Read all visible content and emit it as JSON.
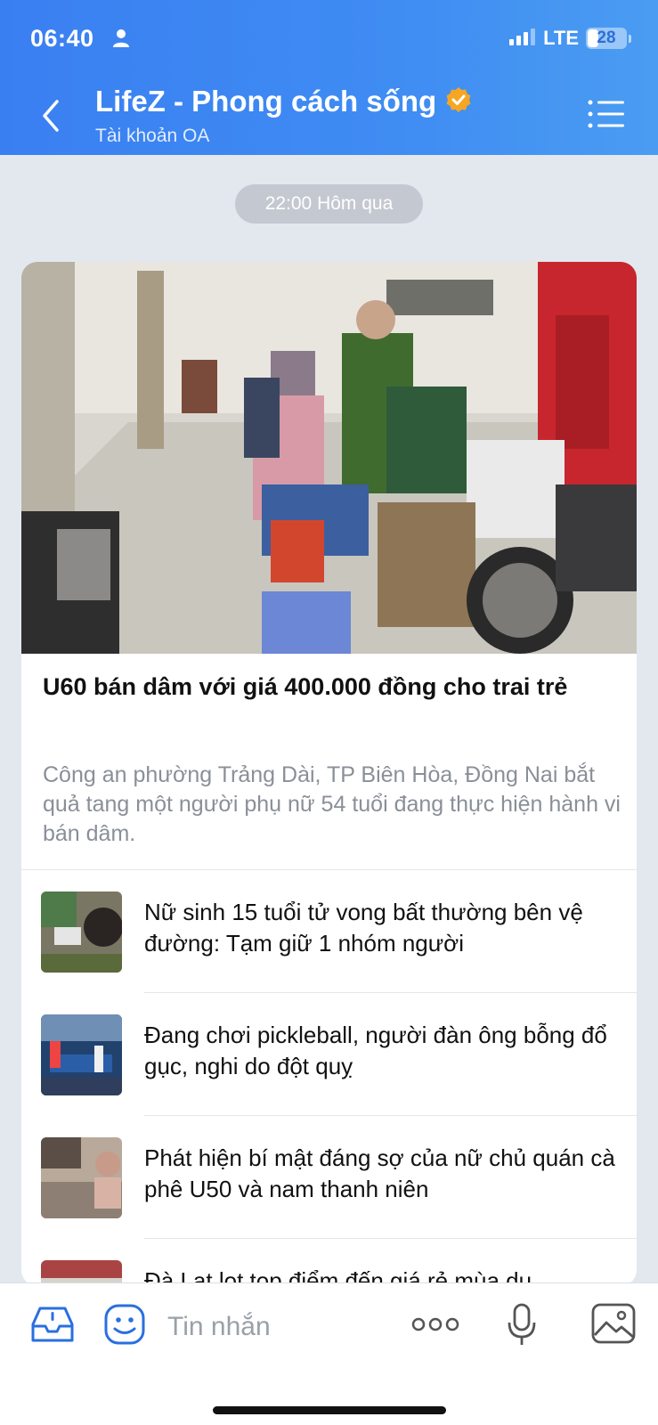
{
  "status_bar": {
    "time": "06:40",
    "network": "LTE",
    "battery": "28"
  },
  "header": {
    "title": "LifeZ - Phong cách sống",
    "subtitle": "Tài khoản OA"
  },
  "chat": {
    "timestamp": "22:00 Hôm qua"
  },
  "article": {
    "title": "U60 bán dâm với giá 400.000 đồng cho trai trẻ",
    "description": "Công an phường Trảng Dài, TP Biên Hòa, Đồng Nai bắt quả tang một người phụ nữ 54 tuổi đang thực hiện hành vi bán dâm."
  },
  "related": [
    {
      "title": "Nữ sinh 15 tuổi tử vong bất thường bên vệ đường: Tạm giữ 1 nhóm người"
    },
    {
      "title": "Đang chơi pickleball, người đàn ông bỗng đổ gục, nghi do đột quỵ"
    },
    {
      "title": "Phát hiện bí mật đáng sợ của nữ chủ quán cà phê U50 và nam thanh niên"
    },
    {
      "title": "Đà Lạt lọt top điểm đến giá rẻ mùa du"
    }
  ],
  "composer": {
    "placeholder": "Tin nhắn"
  },
  "colors": {
    "header_blue": "#3f8cf3",
    "verified_orange": "#f5a623",
    "icon_blue": "#2a6fe0"
  },
  "icons": [
    "person-icon",
    "signal-icon",
    "battery-icon",
    "back-icon",
    "verified-icon",
    "menu-list-icon",
    "inbox-icon",
    "emoji-icon",
    "more-icon",
    "mic-icon",
    "image-icon"
  ]
}
